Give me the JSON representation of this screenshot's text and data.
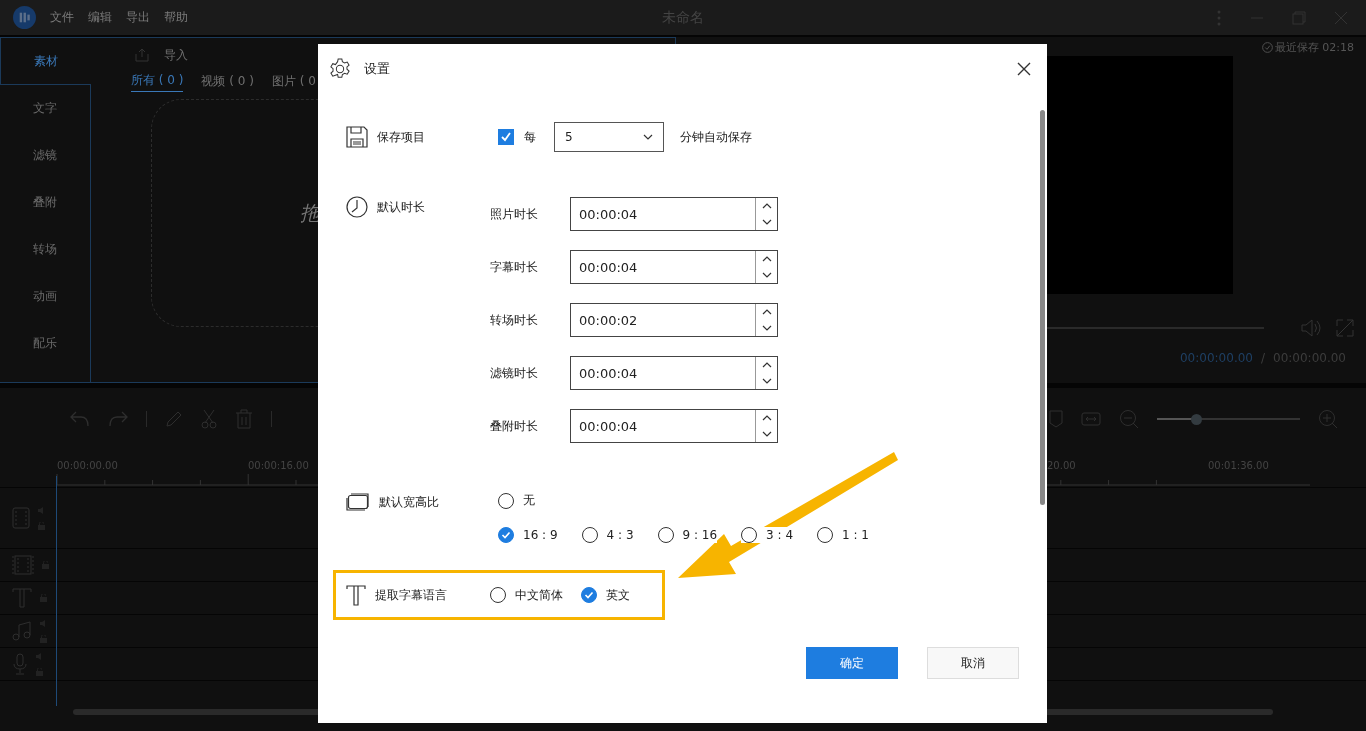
{
  "app": {
    "menu": [
      "文件",
      "编辑",
      "导出",
      "帮助"
    ],
    "title": "未命名"
  },
  "sidebar": [
    {
      "label": "素材",
      "selected": true
    },
    {
      "label": "文字",
      "selected": false
    },
    {
      "label": "滤镜",
      "selected": false
    },
    {
      "label": "叠附",
      "selected": false
    },
    {
      "label": "转场",
      "selected": false
    },
    {
      "label": "动画",
      "selected": false
    },
    {
      "label": "配乐",
      "selected": false
    }
  ],
  "media": {
    "import": "导入",
    "filters": [
      {
        "label": "所有 ( 0 )",
        "selected": true
      },
      {
        "label": "视频 ( 0 )",
        "selected": false
      },
      {
        "label": "图片 ( 0",
        "selected": false
      }
    ],
    "drop_text": "拖"
  },
  "preview": {
    "saved": "最近保存 02:18",
    "current_time": "00:00:00.00",
    "separator": "/",
    "total_time": "00:00:00.00"
  },
  "timeline": {
    "zoom": {
      "level": 0.27
    },
    "ruler": [
      "00:00:00.00",
      "00:00:16.00",
      "20.00",
      "00:01:36.00"
    ]
  },
  "dialog": {
    "title": "设置",
    "save": {
      "label": "保存项目",
      "auto_save": {
        "label": "每",
        "checked": true
      },
      "interval": "5",
      "suffix": "分钟自动保存"
    },
    "duration": {
      "label": "默认时长",
      "fields": [
        {
          "label": "照片时长",
          "value": "00:00:04"
        },
        {
          "label": "字幕时长",
          "value": "00:00:04"
        },
        {
          "label": "转场时长",
          "value": "00:00:02"
        },
        {
          "label": "滤镜时长",
          "value": "00:00:04"
        },
        {
          "label": "叠附时长",
          "value": "00:00:04"
        }
      ]
    },
    "aspect": {
      "label": "默认宽高比",
      "options": [
        {
          "label": "无",
          "selected": false
        },
        {
          "label": "16 : 9",
          "selected": true
        },
        {
          "label": "4 : 3",
          "selected": false
        },
        {
          "label": "9 : 16",
          "selected": false
        },
        {
          "label": "3 : 4",
          "selected": false
        },
        {
          "label": "1 : 1",
          "selected": false
        }
      ]
    },
    "subtitle_language": {
      "label": "提取字幕语言",
      "options": [
        {
          "label": "中文简体",
          "selected": false
        },
        {
          "label": "英文",
          "selected": true
        }
      ]
    },
    "buttons": [
      {
        "label": "确定",
        "kind": "primary"
      },
      {
        "label": "取消",
        "kind": "secondary"
      }
    ]
  }
}
